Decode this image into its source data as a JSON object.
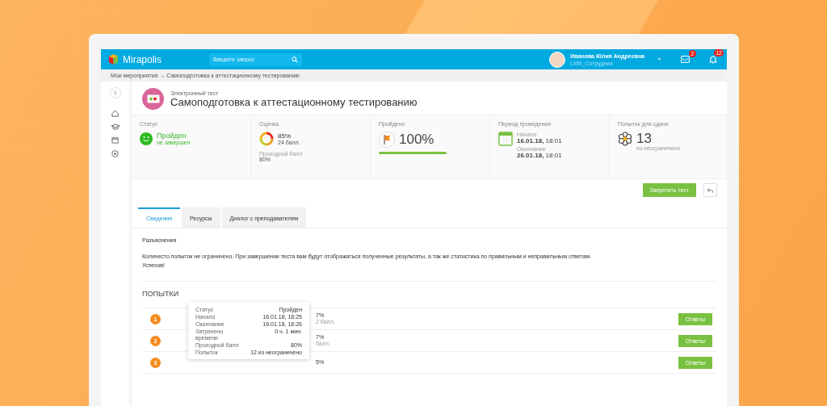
{
  "header": {
    "logo": "Mirapolis",
    "search": {
      "placeholder": "Введите запрос"
    },
    "user": {
      "name": "Иванова Юлия Андреевна",
      "role": "LMS_Сотрудник"
    },
    "messages_badge": "2",
    "notifications_badge": "12"
  },
  "breadcrumb": "Мои мероприятия → Самоподготовка к аттестационному тестированию",
  "page": {
    "type": "Электронный тест",
    "title": "Самоподготовка к аттестационному тестированию"
  },
  "stats": [
    {
      "kind": "status",
      "label": "Статус",
      "value": "Пройден",
      "note": "не завершен"
    },
    {
      "kind": "score",
      "label": "Оценка",
      "value": "85%",
      "note": "24 балл.",
      "sub_label": "Проходной балл",
      "sub_value": "80%"
    },
    {
      "kind": "progress",
      "label": "Пройдено",
      "value": "100%",
      "level": 1
    },
    {
      "kind": "period",
      "label": "Период проведения",
      "start_label": "Начало",
      "start": "**16.01.18,** 18:01",
      "end_label": "Окончание",
      "end": "**26.01.18,** 18:01"
    },
    {
      "kind": "attempts",
      "label": "Попыток для сдачи",
      "value": "13",
      "note": "из неограничено"
    }
  ],
  "start_button": "Запустить тест",
  "tabs": [
    {
      "label": "Сведения",
      "selected": true
    },
    {
      "label": "Ресурсы",
      "selected": false
    },
    {
      "label": "Диалог с преподавателем",
      "selected": false
    }
  ],
  "explanation": {
    "heading": "Разъяснения",
    "text": "Количесто попыток не ограничено. При завершении теста вам будут отображаться полученные результаты, а так же статистика по правильным и неправильным ответам.",
    "closing": "Успехов!"
  },
  "attempts": {
    "heading": "ПОПЫТКИ",
    "rows": [
      {
        "number": "1",
        "score": "7%",
        "points": "2 балл.",
        "button": "Ответы"
      },
      {
        "number": "2",
        "score": "7%",
        "points": "балл.",
        "button": "Ответы"
      },
      {
        "number": "3",
        "score": "5%",
        "button": "Ответы"
      }
    ],
    "tooltip": [
      {
        "label": "Статус",
        "value": "Пройден"
      },
      {
        "label": "Начало",
        "value": "16.01.18, 18:25"
      },
      {
        "label": "Окончание",
        "value": "16.01.18, 18:26"
      },
      {
        "label": "Затрачено времени",
        "value": "0 ч. 1 мин."
      },
      {
        "label": "Проходной балл",
        "value": "80%"
      },
      {
        "label": "Попыток",
        "value": "12 из неограничено"
      }
    ]
  }
}
